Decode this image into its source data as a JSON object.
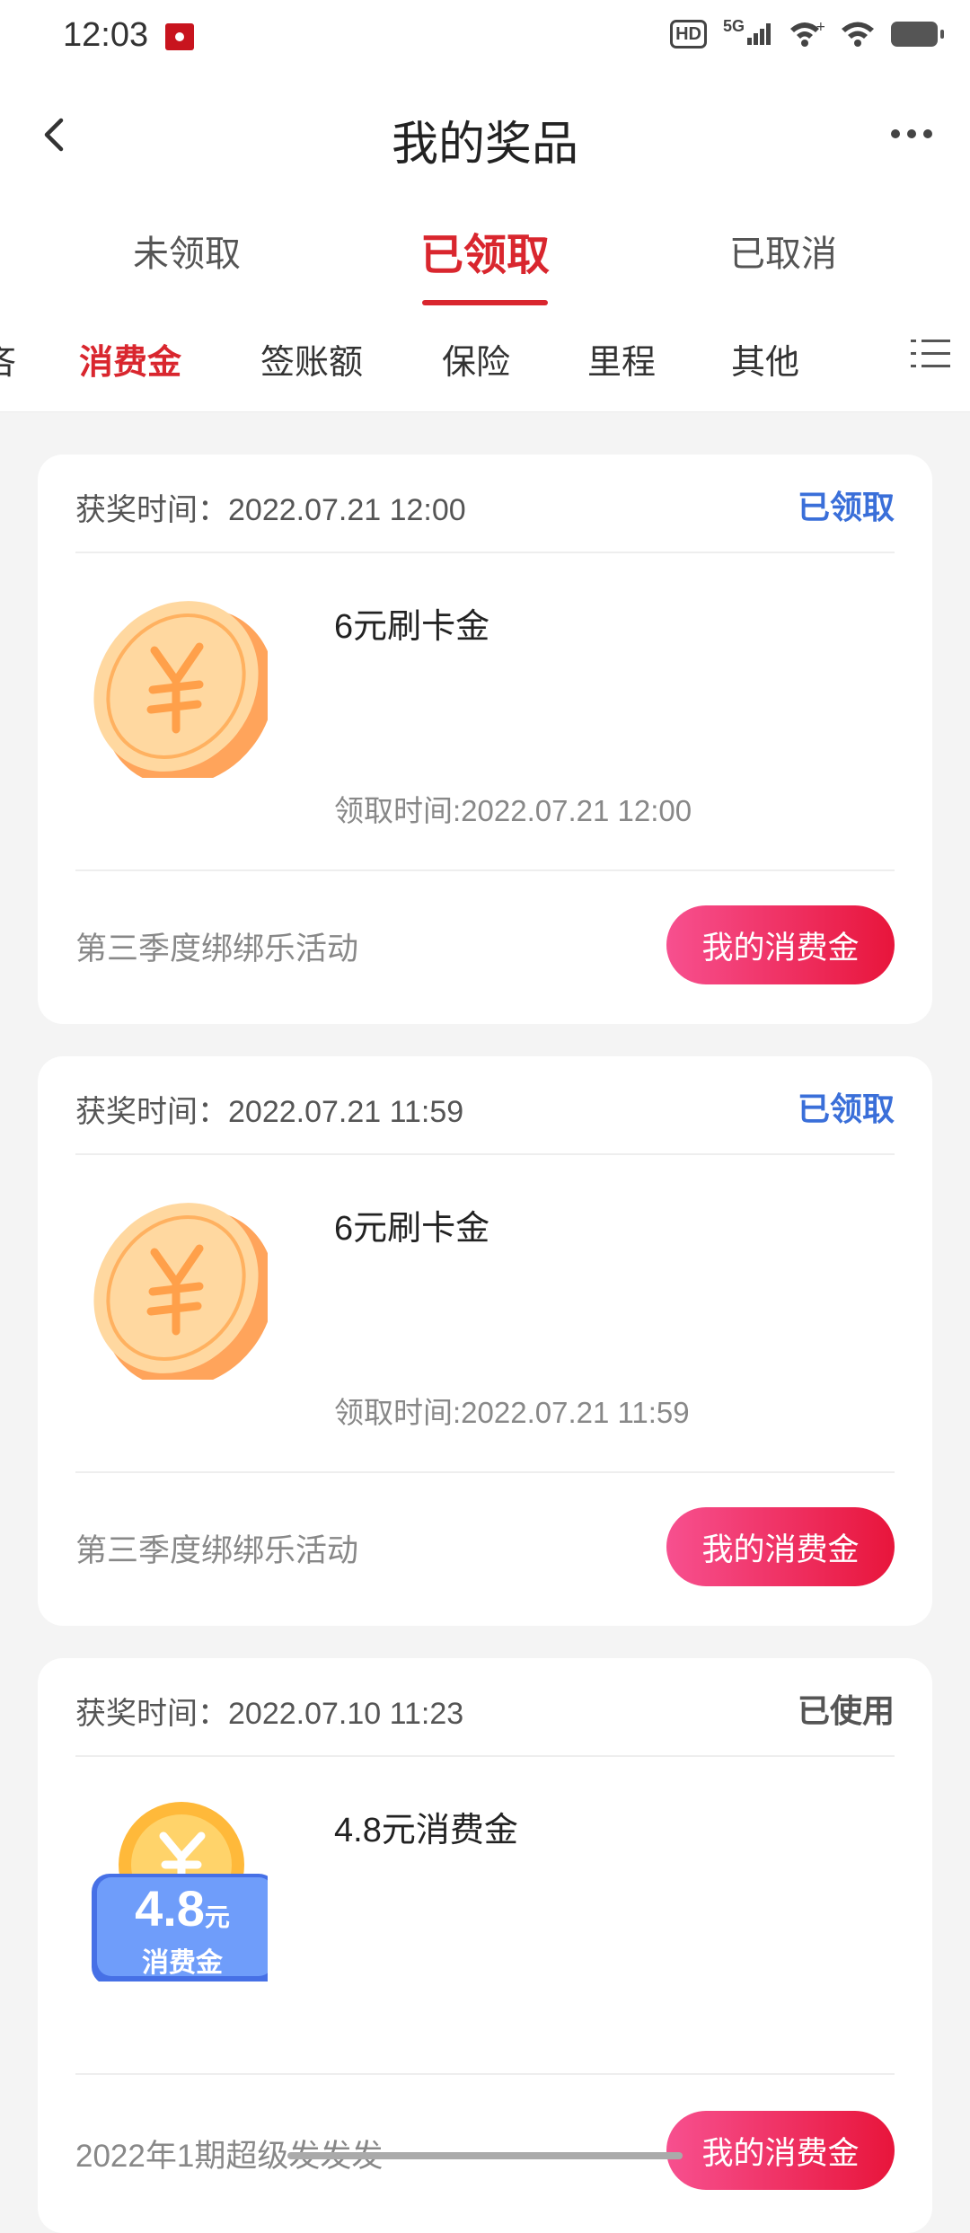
{
  "status_bar": {
    "time": "12:03",
    "hd_label": "HD",
    "network_label": "5G",
    "icons": [
      "notification-app-icon",
      "signal-icon",
      "wifi-plus-icon",
      "wifi-icon",
      "battery-icon"
    ]
  },
  "header": {
    "title": "我的奖品",
    "back_icon": "chevron-left-icon",
    "more_icon": "more-dots-icon"
  },
  "status_tabs": [
    {
      "label": "未领取",
      "active": false
    },
    {
      "label": "已领取",
      "active": true
    },
    {
      "label": "已取消",
      "active": false
    }
  ],
  "category_tabs": {
    "partial_label": "吝",
    "items": [
      "消费金",
      "签账额",
      "保险",
      "里程",
      "其他"
    ],
    "active": "消费金",
    "menu_icon": "list-icon"
  },
  "colors": {
    "accent": "#d9262e",
    "claimed_status": "#3a6fd9",
    "button_gradient_start": "#f7508f",
    "button_gradient_end": "#e8153b"
  },
  "prizes": [
    {
      "award_time": "获奖时间：2022.07.21 12:00",
      "status": "已领取",
      "name": "6元刷卡金",
      "claim_time": "领取时间:2022.07.21 12:00",
      "activity": "第三季度绑绑乐活动",
      "button": "我的消费金",
      "icon": "yuan-coin-icon"
    },
    {
      "award_time": "获奖时间：2022.07.21 11:59",
      "status": "已领取",
      "name": "6元刷卡金",
      "claim_time": "领取时间:2022.07.21 11:59",
      "activity": "第三季度绑绑乐活动",
      "button": "我的消费金",
      "icon": "yuan-coin-icon"
    },
    {
      "award_time": "获奖时间：2022.07.10 11:23",
      "status": "已使用",
      "name": "4.8元消费金",
      "claim_time": "",
      "activity": "2022年1期超级发发发",
      "button": "我的消费金",
      "icon": "consumption-voucher-icon",
      "badge_amount": "4.8",
      "badge_unit": "元",
      "badge_text": "消费金"
    }
  ]
}
